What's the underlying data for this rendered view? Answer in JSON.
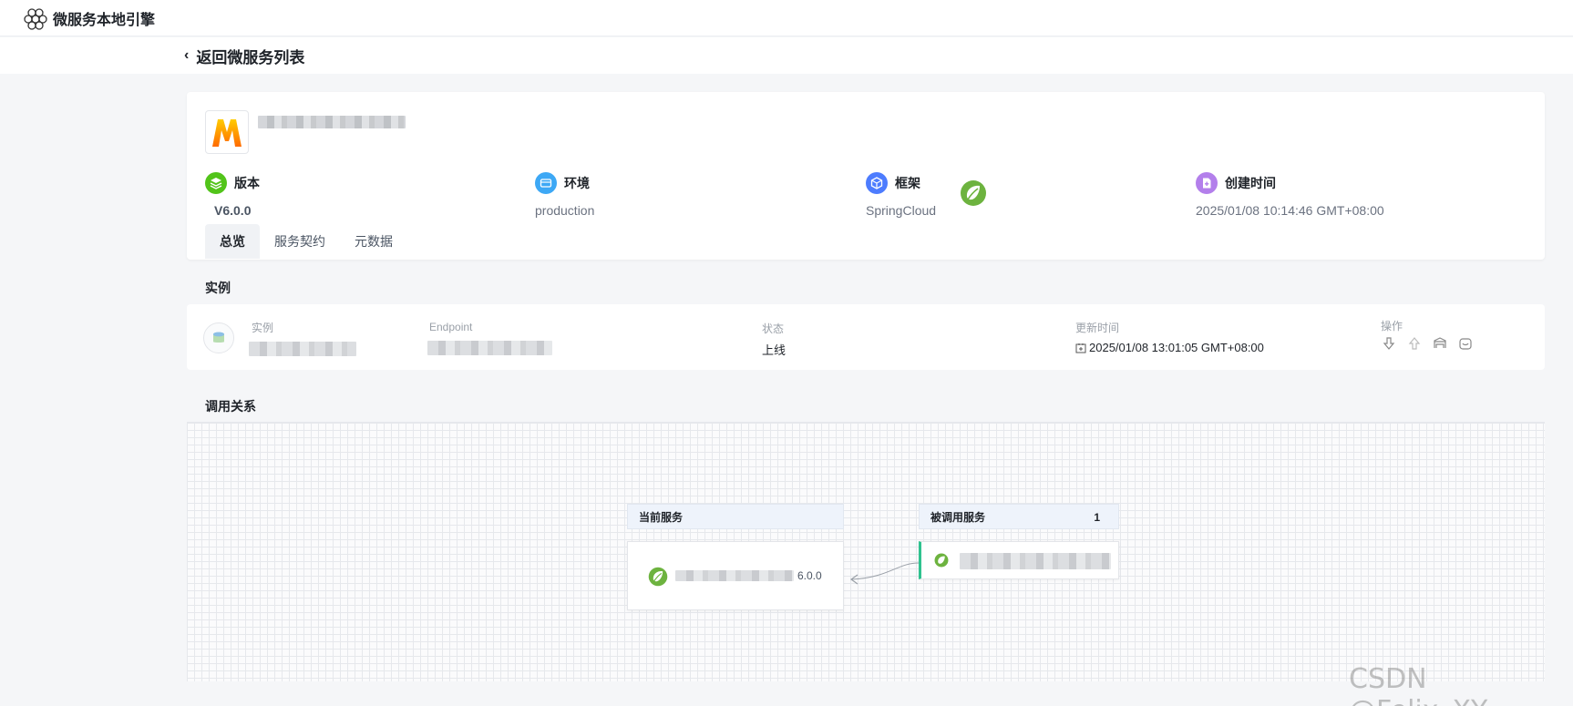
{
  "app": {
    "title": "微服务本地引擎",
    "logo_icon": "hexagon-cluster-icon"
  },
  "nav": {
    "back_label": "返回微服务列表"
  },
  "service": {
    "logo_icon": "m-brand-logo-icon",
    "meta": [
      {
        "label": "版本",
        "value": "V6.0.0",
        "icon": "layers-icon",
        "color": "#52c41a"
      },
      {
        "label": "环境",
        "value": "production",
        "icon": "environment-icon",
        "color": "#3da8f5"
      },
      {
        "label": "框架",
        "value": "SpringCloud",
        "icon": "cube-icon",
        "color": "#4d7cfe"
      },
      {
        "label": "创建时间",
        "value": "2025/01/08 10:14:46 GMT+08:00",
        "icon": "file-add-icon",
        "color": "#b37feb"
      }
    ],
    "framework_logo_icon": "spring-leaf-icon"
  },
  "tabs": [
    {
      "label": "总览",
      "active": true
    },
    {
      "label": "服务契约",
      "active": false
    },
    {
      "label": "元数据",
      "active": false
    }
  ],
  "instances": {
    "title": "实例",
    "columns": {
      "instance": "实例",
      "endpoint": "Endpoint",
      "status": "状态",
      "updated": "更新时间",
      "ops": "操作"
    },
    "rows": [
      {
        "status": "上线",
        "updated": "2025/01/08 13:01:05 GMT+08:00"
      }
    ],
    "op_icons": [
      "download-icon",
      "upload-icon",
      "offline-icon",
      "log-icon"
    ]
  },
  "relations": {
    "title": "调用关系",
    "current": {
      "header": "当前服务",
      "version": "6.0.0"
    },
    "callee": {
      "header": "被调用服务",
      "count": "1"
    }
  },
  "watermark": "CSDN @Felix_XY"
}
